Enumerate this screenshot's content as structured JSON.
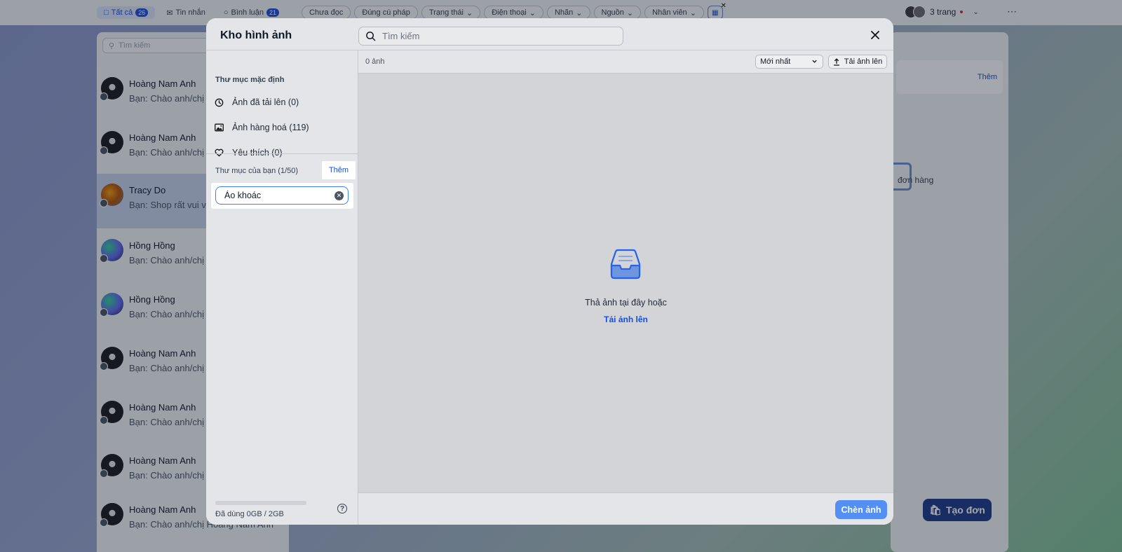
{
  "topbar": {
    "tabs": [
      {
        "label": "Tất cả",
        "badge": "26"
      },
      {
        "label": "Tin nhắn",
        "badge": ""
      },
      {
        "label": "Bình luận",
        "badge": "21"
      }
    ],
    "filters": [
      "Chưa đọc",
      "Đúng cú pháp",
      "Trạng thái",
      "Điện thoại",
      "Nhãn",
      "Nguồn",
      "Nhân viên"
    ],
    "page_count": "3 trang"
  },
  "conversations": {
    "search_placeholder": "Tìm kiếm",
    "items": [
      {
        "name": "Hoàng Nam Anh",
        "msg": "Bạn: Chào anh/chị Ho"
      },
      {
        "name": "Hoàng Nam Anh",
        "msg": "Bạn: Chào anh/chị Ho"
      },
      {
        "name": "Tracy Do",
        "msg": "Bạn: Shop rất vui vì b"
      },
      {
        "name": "Hồng Hồng",
        "msg": "Bạn: Chào anh/chị Hồ"
      },
      {
        "name": "Hồng Hồng",
        "msg": "Bạn: Chào anh/chị Hồ"
      },
      {
        "name": "Hoàng Nam Anh",
        "msg": "Bạn: Chào anh/chị Ho"
      },
      {
        "name": "Hoàng Nam Anh",
        "msg": "Bạn: Chào anh/chị Ho"
      },
      {
        "name": "Hoàng Nam Anh",
        "msg": "Bạn: Chào anh/chị Ho"
      },
      {
        "name": "Hoàng Nam Anh",
        "msg": "Bạn: Chào anh/chị Hoàng Nam Anh"
      }
    ]
  },
  "right_panel": {
    "more_label": "Thêm",
    "empty_text": "đơn hàng",
    "create_order_label": "Tạo đơn"
  },
  "modal": {
    "title": "Kho hình ảnh",
    "search_placeholder": "Tìm kiếm",
    "default_folders_title": "Thư mục mặc định",
    "default_folders": [
      {
        "label": "Ảnh đã tải lên (0)",
        "icon": "clock-icon"
      },
      {
        "label": "Ảnh hàng hoá (119)",
        "icon": "image-icon"
      },
      {
        "label": "Yêu thích (0)",
        "icon": "heart-icon"
      }
    ],
    "user_folders_title": "Thư mục của bạn (1/50)",
    "add_folder_label": "Thêm",
    "new_folder_value": "Áo khoác",
    "storage_text": "Đã dùng 0GB / 2GB",
    "storage_used_fraction": 0,
    "image_count": "0 ảnh",
    "sort_value": "Mới nhất",
    "upload_label": "Tải ảnh lên",
    "dropzone_text": "Thả ảnh tại đây hoặc",
    "dropzone_link": "Tải ảnh lên",
    "insert_label": "Chèn ảnh"
  },
  "colors": {
    "accent": "#3b82f6",
    "link": "#1d4ed8",
    "create_order_bg": "#1e3a8a"
  }
}
